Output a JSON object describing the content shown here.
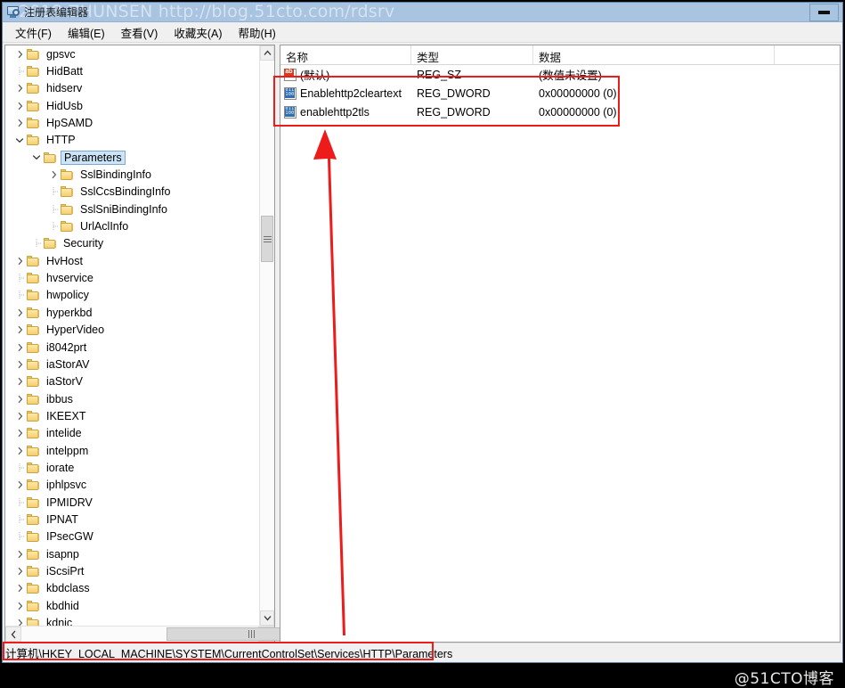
{
  "window": {
    "title": "注册表编辑器",
    "watermark_title": "2018 ZHUNSEN http://blog.51cto.com/rdsrv",
    "minimize_label": "最小化"
  },
  "menu": {
    "items": [
      {
        "label": "文件(F)",
        "name": "menu-file"
      },
      {
        "label": "编辑(E)",
        "name": "menu-edit"
      },
      {
        "label": "查看(V)",
        "name": "menu-view"
      },
      {
        "label": "收藏夹(A)",
        "name": "menu-favorites"
      },
      {
        "label": "帮助(H)",
        "name": "menu-help"
      }
    ]
  },
  "tree": {
    "nodes": [
      {
        "label": "gpsvc",
        "depth": 1,
        "twist": "collapsed",
        "selected": false
      },
      {
        "label": "HidBatt",
        "depth": 1,
        "twist": "none",
        "selected": false
      },
      {
        "label": "hidserv",
        "depth": 1,
        "twist": "collapsed",
        "selected": false
      },
      {
        "label": "HidUsb",
        "depth": 1,
        "twist": "collapsed",
        "selected": false
      },
      {
        "label": "HpSAMD",
        "depth": 1,
        "twist": "collapsed",
        "selected": false
      },
      {
        "label": "HTTP",
        "depth": 1,
        "twist": "expanded",
        "selected": false
      },
      {
        "label": "Parameters",
        "depth": 2,
        "twist": "expanded",
        "selected": true
      },
      {
        "label": "SslBindingInfo",
        "depth": 3,
        "twist": "collapsed",
        "selected": false
      },
      {
        "label": "SslCcsBindingInfo",
        "depth": 3,
        "twist": "none",
        "selected": false
      },
      {
        "label": "SslSniBindingInfo",
        "depth": 3,
        "twist": "none",
        "selected": false
      },
      {
        "label": "UrlAclInfo",
        "depth": 3,
        "twist": "none",
        "selected": false
      },
      {
        "label": "Security",
        "depth": 2,
        "twist": "none",
        "selected": false
      },
      {
        "label": "HvHost",
        "depth": 1,
        "twist": "collapsed",
        "selected": false
      },
      {
        "label": "hvservice",
        "depth": 1,
        "twist": "none",
        "selected": false
      },
      {
        "label": "hwpolicy",
        "depth": 1,
        "twist": "none",
        "selected": false
      },
      {
        "label": "hyperkbd",
        "depth": 1,
        "twist": "collapsed",
        "selected": false
      },
      {
        "label": "HyperVideo",
        "depth": 1,
        "twist": "collapsed",
        "selected": false
      },
      {
        "label": "i8042prt",
        "depth": 1,
        "twist": "collapsed",
        "selected": false
      },
      {
        "label": "iaStorAV",
        "depth": 1,
        "twist": "collapsed",
        "selected": false
      },
      {
        "label": "iaStorV",
        "depth": 1,
        "twist": "collapsed",
        "selected": false
      },
      {
        "label": "ibbus",
        "depth": 1,
        "twist": "collapsed",
        "selected": false
      },
      {
        "label": "IKEEXT",
        "depth": 1,
        "twist": "collapsed",
        "selected": false
      },
      {
        "label": "intelide",
        "depth": 1,
        "twist": "collapsed",
        "selected": false
      },
      {
        "label": "intelppm",
        "depth": 1,
        "twist": "collapsed",
        "selected": false
      },
      {
        "label": "iorate",
        "depth": 1,
        "twist": "none",
        "selected": false
      },
      {
        "label": "iphlpsvc",
        "depth": 1,
        "twist": "collapsed",
        "selected": false
      },
      {
        "label": "IPMIDRV",
        "depth": 1,
        "twist": "none",
        "selected": false
      },
      {
        "label": "IPNAT",
        "depth": 1,
        "twist": "none",
        "selected": false
      },
      {
        "label": "IPsecGW",
        "depth": 1,
        "twist": "none",
        "selected": false
      },
      {
        "label": "isapnp",
        "depth": 1,
        "twist": "collapsed",
        "selected": false
      },
      {
        "label": "iScsiPrt",
        "depth": 1,
        "twist": "collapsed",
        "selected": false
      },
      {
        "label": "kbdclass",
        "depth": 1,
        "twist": "collapsed",
        "selected": false
      },
      {
        "label": "kbdhid",
        "depth": 1,
        "twist": "collapsed",
        "selected": false
      },
      {
        "label": "kdnic",
        "depth": 1,
        "twist": "collapsed",
        "selected": false
      }
    ]
  },
  "list": {
    "columns": [
      "名称",
      "类型",
      "数据"
    ],
    "rows": [
      {
        "icon": "string-value-icon",
        "name": "(默认)",
        "type": "REG_SZ",
        "data": "(数值未设置)"
      },
      {
        "icon": "dword-value-icon",
        "name": "Enablehttp2cleartext",
        "type": "REG_DWORD",
        "data": "0x00000000 (0)"
      },
      {
        "icon": "dword-value-icon",
        "name": "enablehttp2tls",
        "type": "REG_DWORD",
        "data": "0x00000000 (0)"
      }
    ]
  },
  "statusbar": {
    "path": "计算机\\HKEY_LOCAL_MACHINE\\SYSTEM\\CurrentControlSet\\Services\\HTTP\\Parameters"
  },
  "annotations": {
    "highlight_values_box": "红色框：新建的两个 DWORD 值",
    "highlight_path_box": "红色框：注册表路径",
    "arrow": "红色向上箭头指向新建的值"
  },
  "watermark": {
    "bottom": "@51CTO博客"
  },
  "colors": {
    "accent_red": "#ee1b1b",
    "titlebar": "#a8c4e0",
    "selection": "#cce4f7",
    "folder": "#f4cf72"
  }
}
